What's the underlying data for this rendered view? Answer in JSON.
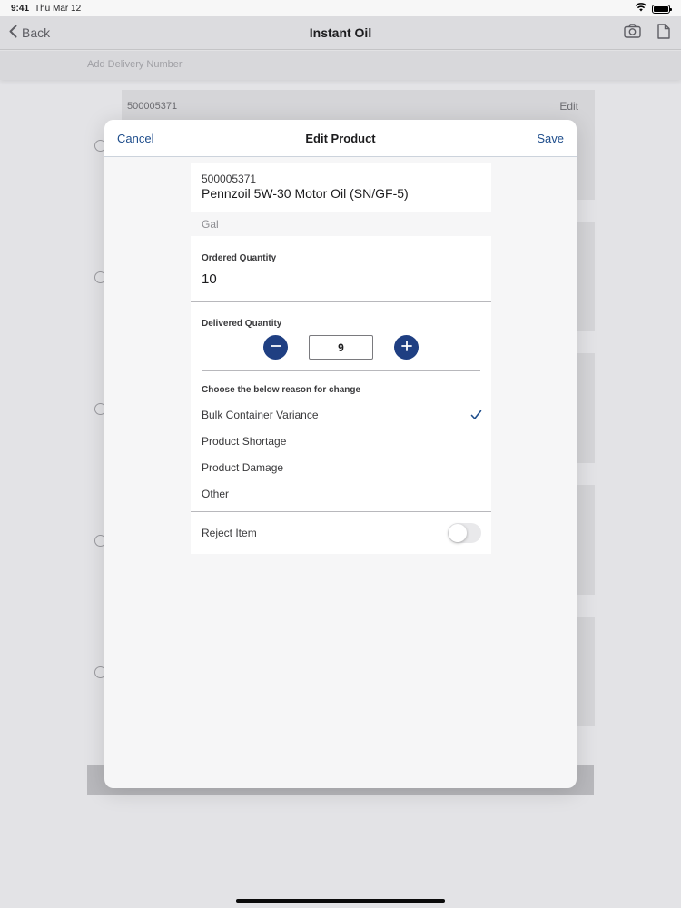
{
  "status_bar": {
    "time": "9:41",
    "date": "Thu Mar 12",
    "battery": 1.0
  },
  "nav": {
    "back_label": "Back",
    "title": "Instant Oil",
    "icons": [
      "camera-icon",
      "document-icon"
    ]
  },
  "sub_bar": {
    "placeholder": "Add Delivery Number"
  },
  "background_card": {
    "id": "500005371",
    "edit_label": "Edit"
  },
  "modal": {
    "cancel_label": "Cancel",
    "title": "Edit Product",
    "save_label": "Save",
    "product": {
      "id": "500005371",
      "name": "Pennzoil 5W-30 Motor Oil (SN/GF-5)"
    },
    "unit": "Gal",
    "ordered": {
      "label": "Ordered Quantity",
      "value": "10"
    },
    "delivered": {
      "label": "Delivered Quantity",
      "value": "9"
    },
    "reasons": {
      "header": "Choose the below reason for change",
      "items": [
        {
          "label": "Bulk Container Variance",
          "selected": true
        },
        {
          "label": "Product Shortage",
          "selected": false
        },
        {
          "label": "Product Damage",
          "selected": false
        },
        {
          "label": "Other",
          "selected": false
        }
      ]
    },
    "reject": {
      "label": "Reject Item",
      "on": false
    }
  },
  "colors": {
    "accent": "#1f4e8c",
    "stepper": "#1f3f82",
    "modal_bg": "#f6f6f7"
  }
}
